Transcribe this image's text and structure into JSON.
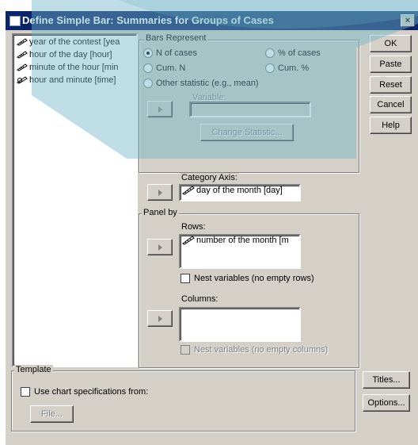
{
  "window": {
    "title": "Define Simple Bar: Summaries for Groups of Cases",
    "close_label": "×"
  },
  "variables": [
    {
      "label": "year of the contest [yea",
      "icon": "ruler-icon"
    },
    {
      "label": "hour of the day [hour]",
      "icon": "ruler-icon"
    },
    {
      "label": "minute of the hour [min",
      "icon": "ruler-icon"
    },
    {
      "label": "hour and minute [time]",
      "icon": "scale-icon"
    }
  ],
  "bars_represent": {
    "label": "Bars Represent",
    "n_of_cases": "N of cases",
    "pct_of_cases": "% of cases",
    "cum_n": "Cum. N",
    "cum_pct": "Cum. %",
    "other_statistic": "Other statistic (e.g., mean)",
    "variable_label": "Variable:",
    "change_statistic": "Change Statistic..."
  },
  "category_axis": {
    "label": "Category Axis:",
    "value": "day of the month [day]"
  },
  "panel_by": {
    "label": "Panel by",
    "rows_label": "Rows:",
    "rows_value": "number of the month [m",
    "nest_rows": "Nest variables (no empty rows)",
    "columns_label": "Columns:",
    "nest_columns": "Nest variables (no empty columns)"
  },
  "buttons": {
    "ok": "OK",
    "paste": "Paste",
    "reset": "Reset",
    "cancel": "Cancel",
    "help": "Help",
    "titles": "Titles...",
    "options": "Options..."
  },
  "template": {
    "label": "Template",
    "use_chart_specs": "Use chart specifications from:",
    "file": "File..."
  },
  "colors": {
    "titlebar": "#0a246a",
    "dialog": "#d4d0c8",
    "overlay": "#6fb4c4"
  }
}
